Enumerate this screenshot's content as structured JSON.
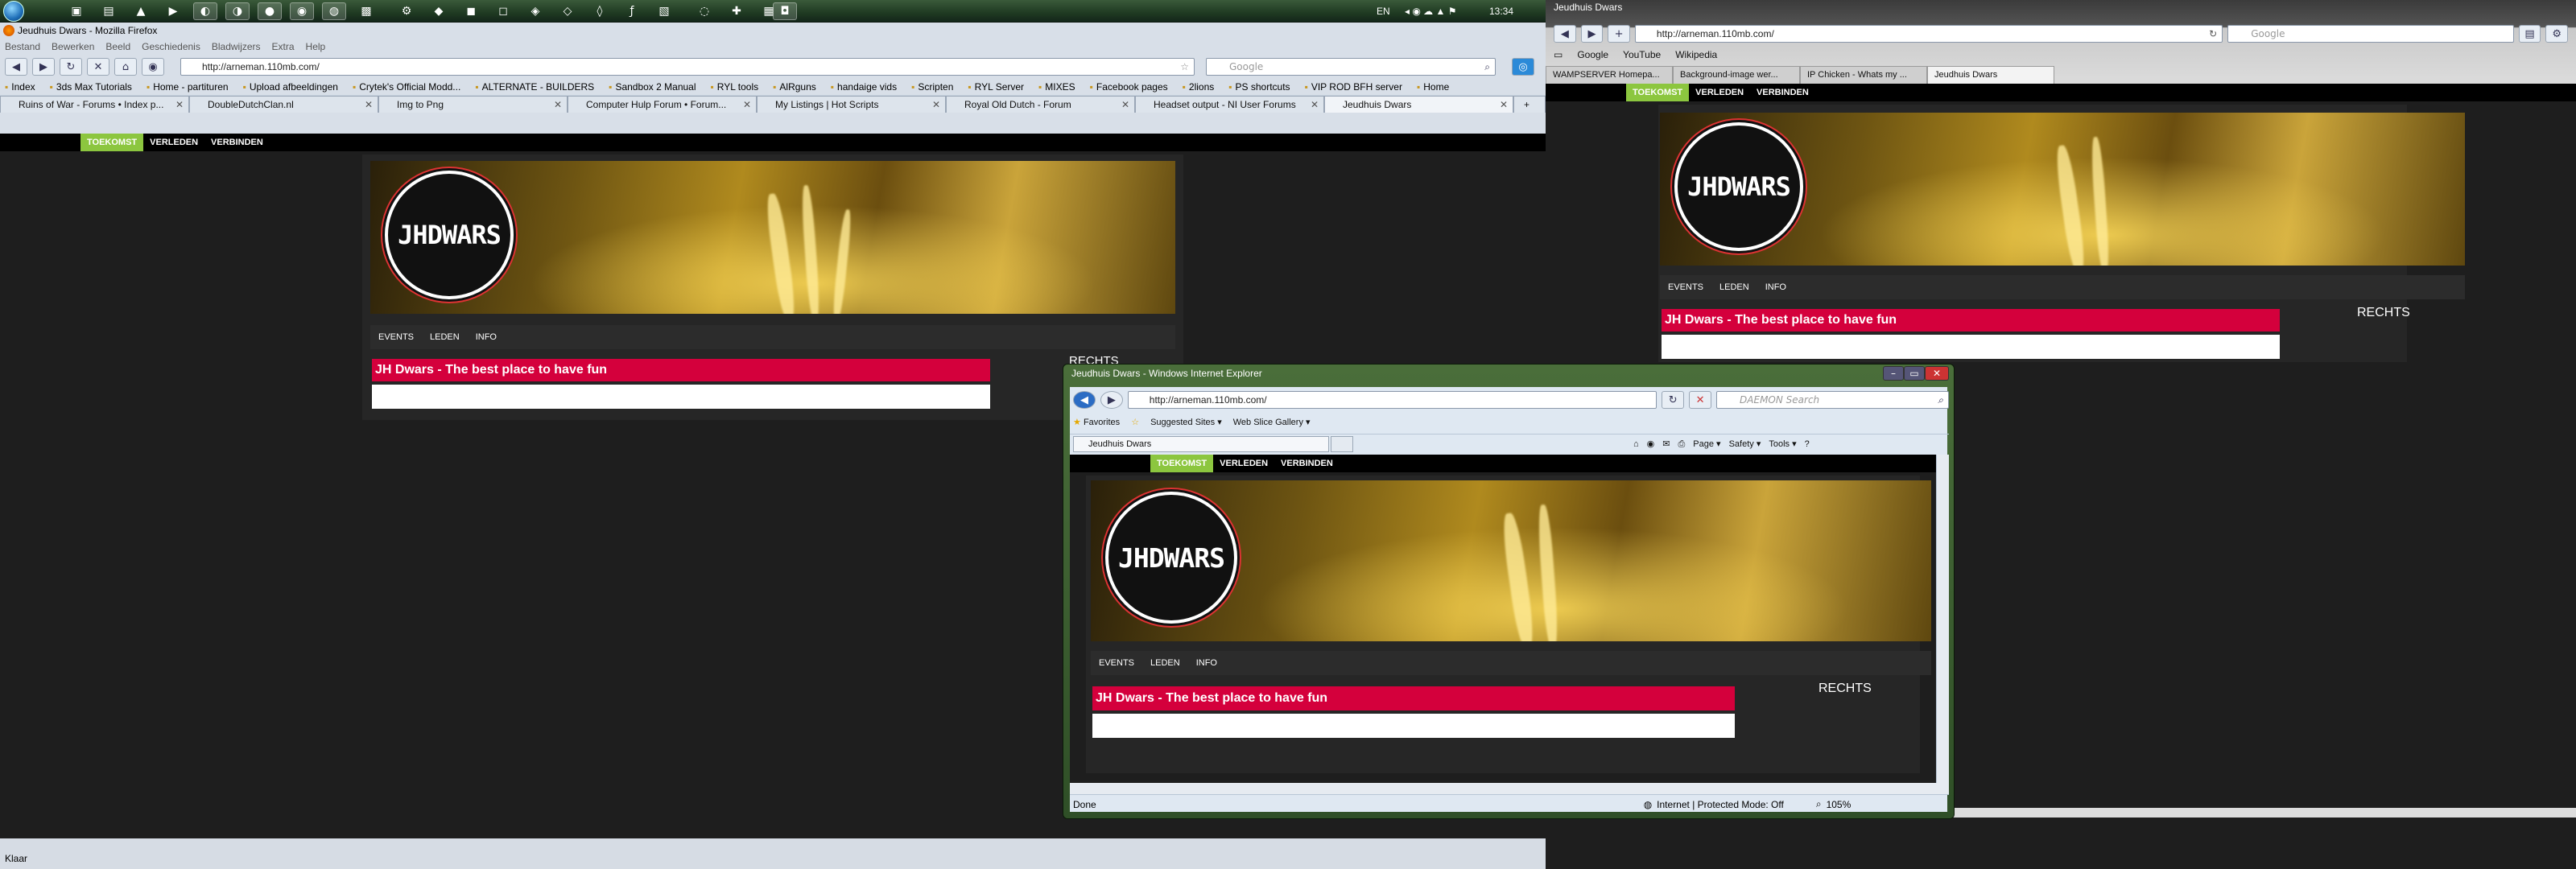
{
  "taskbar": {
    "tray_lang": "EN",
    "clock": "13:34"
  },
  "firefox": {
    "title": "Jeudhuis Dwars - Mozilla Firefox",
    "menu": [
      "Bestand",
      "Bewerken",
      "Beeld",
      "Geschiedenis",
      "Bladwijzers",
      "Extra",
      "Help"
    ],
    "url": "http://arneman.110mb.com/",
    "search_placeholder": "Google",
    "bookmarks": [
      "Index",
      "3ds Max Tutorials",
      "Home - partituren",
      "Upload afbeeldingen",
      "Crytek's Official Modd...",
      "ALTERNATE - BUILDERS",
      "Sandbox 2 Manual",
      "RYL tools",
      "AlRguns",
      "handaige vids",
      "Scripten",
      "RYL Server",
      "MIXES",
      "Facebook pages",
      "2lions",
      "PS shortcuts",
      "VIP ROD BFH server",
      "Home"
    ],
    "tabs": [
      {
        "label": "Ruins of War - Forums • Index p..."
      },
      {
        "label": "DoubleDutchClan.nl"
      },
      {
        "label": "Img to Png"
      },
      {
        "label": "Computer Hulp Forum • Forum..."
      },
      {
        "label": "My Listings | Hot Scripts"
      },
      {
        "label": "Royal Old Dutch - Forum"
      },
      {
        "label": "Headset output - NI User Forums"
      },
      {
        "label": "Jeudhuis Dwars"
      }
    ],
    "status": "Klaar"
  },
  "site": {
    "nav": [
      "TOEKOMST",
      "VERLEDEN",
      "VERBINDEN"
    ],
    "logo": "JHDWARS",
    "subnav": [
      "EVENTS",
      "LEDEN",
      "INFO"
    ],
    "headline": "JH Dwars - The best place to have fun",
    "side_label": "RECHTS",
    "side_label_cut": "RECHTS"
  },
  "chrome": {
    "title": "Jeudhuis Dwars",
    "url": "http://arneman.110mb.com/",
    "search_placeholder": "Google",
    "bookmarks": [
      "Google",
      "YouTube",
      "Wikipedia"
    ],
    "tabs": [
      "WAMPSERVER Homepa...",
      "Background-image wer...",
      "IP Chicken - Whats my ...",
      "Jeudhuis Dwars"
    ]
  },
  "ie": {
    "title": "Jeudhuis Dwars - Windows Internet Explorer",
    "url": "http://arneman.110mb.com/",
    "search_placeholder": "DAEMON Search",
    "favorites": "Favorites",
    "suggested": "Suggested Sites ▾",
    "webslice": "Web Slice Gallery ▾",
    "tab": "Jeudhuis Dwars",
    "commands": [
      "Page ▾",
      "Safety ▾",
      "Tools ▾"
    ],
    "status_left": "Done",
    "status_zone": "Internet | Protected Mode: Off",
    "zoom": "105%"
  }
}
